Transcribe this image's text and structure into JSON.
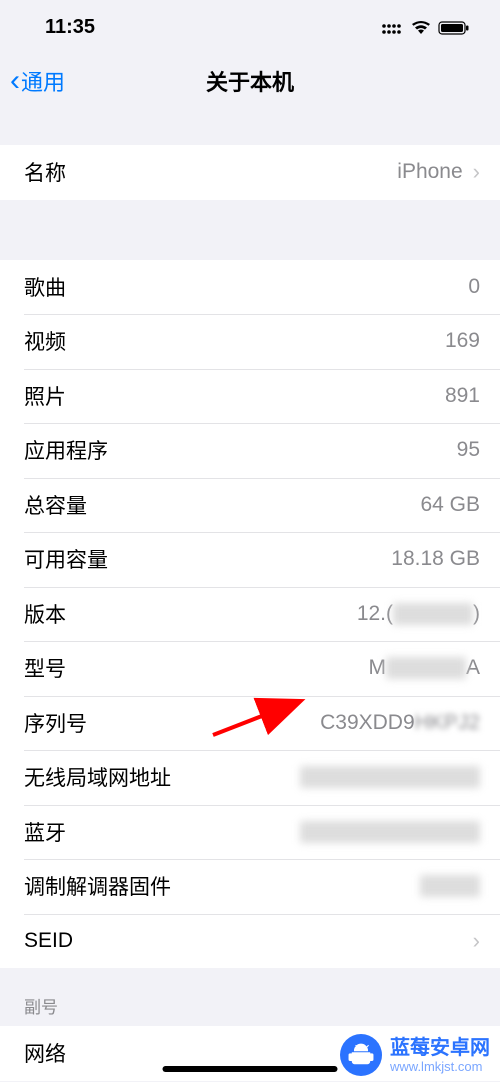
{
  "status_bar": {
    "time": "11:35"
  },
  "nav": {
    "back_label": "通用",
    "title": "关于本机"
  },
  "group1": {
    "name_label": "名称",
    "name_value": "iPhone"
  },
  "group2": {
    "songs_label": "歌曲",
    "songs_value": "0",
    "videos_label": "视频",
    "videos_value": "169",
    "photos_label": "照片",
    "photos_value": "891",
    "apps_label": "应用程序",
    "apps_value": "95",
    "total_label": "总容量",
    "total_value": "64 GB",
    "avail_label": "可用容量",
    "avail_value": "18.18 GB",
    "version_label": "版本",
    "version_value_visible": "12.(",
    "version_value_suffix": ")",
    "model_label": "型号",
    "model_value_prefix": "M",
    "model_value_suffix": "A",
    "serial_label": "序列号",
    "serial_value_prefix": "C39XDD9",
    "serial_value_blur": "HKPJ2",
    "wifi_label": "无线局域网地址",
    "bt_label": "蓝牙",
    "modem_label": "调制解调器固件",
    "seid_label": "SEID"
  },
  "section": {
    "subnum_header": "副号",
    "network_label": "网络"
  },
  "watermark": {
    "title": "蓝莓安卓网",
    "url": "www.lmkjst.com"
  }
}
